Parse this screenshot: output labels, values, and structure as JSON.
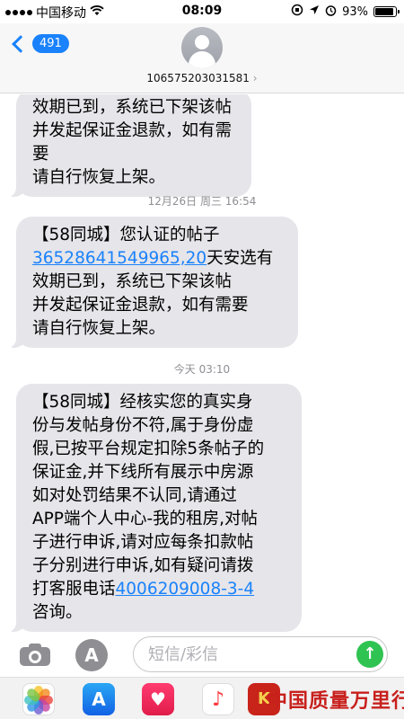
{
  "status_bar": {
    "carrier": "中国移动",
    "time": "08:09",
    "battery_percent": "93%",
    "battery_level": 0.93
  },
  "header": {
    "back_count": "491",
    "contact": "10657520303158​1",
    "contact_display": "106575203031581"
  },
  "messages": [
    {
      "text_lines": [
        "效期已到，系统已下架该帖",
        "并发起保证金退款，如有需要",
        "请自行恢复上架。"
      ]
    },
    {
      "timestamp": "12月26日 周三 16:54",
      "prefix": "【58同城】您认证的帖子",
      "link": "36528641549965,20",
      "after_link": "天安选有",
      "text_lines": [
        "效期已到，系统已下架该帖",
        "并发起保证金退款，如有需要",
        "请自行恢复上架。"
      ]
    },
    {
      "timestamp": "今天 03:10",
      "text_lines": [
        "【58同城】经核实您的真实身",
        "份与发帖身份不符,属于身份虚",
        "假,已按平台规定扣除5条帖子的",
        "保证金,并下线所有展示中房源",
        "如对处罚结果不认同,请通过",
        "APP端个人中心-我的租房,对帖",
        "子进行申诉,请对应每条扣款帖",
        "子分别进行申诉,如有疑问请拨"
      ],
      "phone_prefix": "打客服电话",
      "phone": "4006209008-3-4",
      "ending": "咨询。"
    }
  ],
  "composer": {
    "placeholder": "短信/彩信"
  },
  "watermark": "中国质量万里行"
}
